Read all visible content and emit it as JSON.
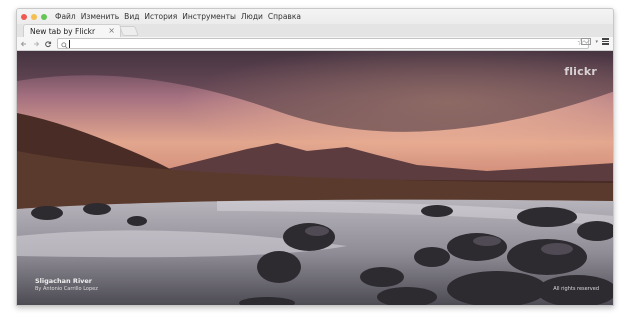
{
  "window": {
    "traffic_lights": {
      "close": "#ee5a52",
      "minimize": "#f5be4f",
      "zoom": "#62c554"
    }
  },
  "menubar": {
    "items": [
      "Файл",
      "Изменить",
      "Вид",
      "История",
      "Инструменты",
      "Люди",
      "Справка"
    ]
  },
  "tabs": [
    {
      "title": "New tab by Flickr",
      "close": "×"
    }
  ],
  "toolbar": {
    "back_icon": "back-arrow-icon",
    "forward_icon": "forward-arrow-icon",
    "reload_icon": "reload-icon",
    "search_icon": "search-icon",
    "omnibox_value": "",
    "bookmark_icon": "star-icon",
    "mail_icon": "mail-icon",
    "menu_icon": "hamburger-menu-icon"
  },
  "photo": {
    "brand": "flickr",
    "title": "Sligachan River",
    "author": "By Antonio Carrillo Lopez",
    "rights": "All rights reserved"
  }
}
